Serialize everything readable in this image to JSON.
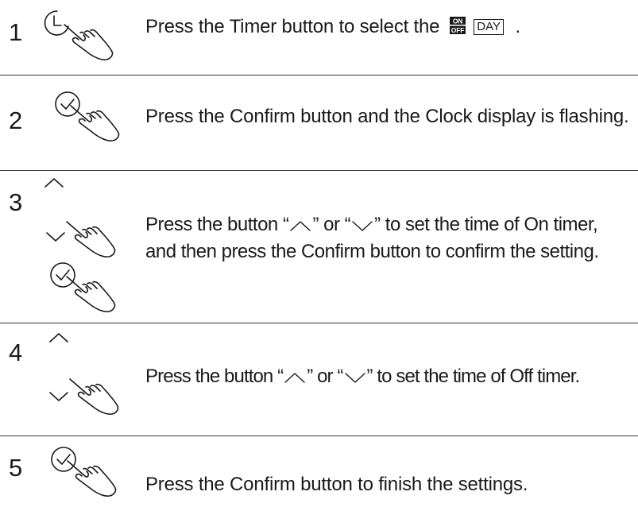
{
  "steps": [
    {
      "number": "1",
      "text_before": "Press the Timer button to select the",
      "on_label": "ON",
      "off_label": "OFF",
      "day_label": "DAY",
      "text_after": "."
    },
    {
      "number": "2",
      "text": "Press the Confirm button and the Clock display is flashing."
    },
    {
      "number": "3",
      "line1_a": "Press the button “",
      "line1_b": "” or “",
      "line1_c": "” to set the time of On timer,",
      "line2": "and then press the Confirm button to confirm the setting."
    },
    {
      "number": "4",
      "line1_a": "Press the button “",
      "line1_b": "” or “",
      "line1_c": "” to set the time of Off timer."
    },
    {
      "number": "5",
      "text": "Press the Confirm button to finish the settings."
    }
  ],
  "icons": {
    "step1": [
      "timer-clock-icon",
      "pointing-hand-icon"
    ],
    "step2": [
      "confirm-check-icon",
      "pointing-hand-icon"
    ],
    "step3": [
      "up-arrow-icon",
      "down-arrow-icon",
      "pointing-hand-icon",
      "confirm-check-icon",
      "pointing-hand-icon"
    ],
    "step4": [
      "up-arrow-icon",
      "down-arrow-icon",
      "pointing-hand-icon"
    ],
    "step5": [
      "confirm-check-icon",
      "pointing-hand-icon"
    ]
  }
}
